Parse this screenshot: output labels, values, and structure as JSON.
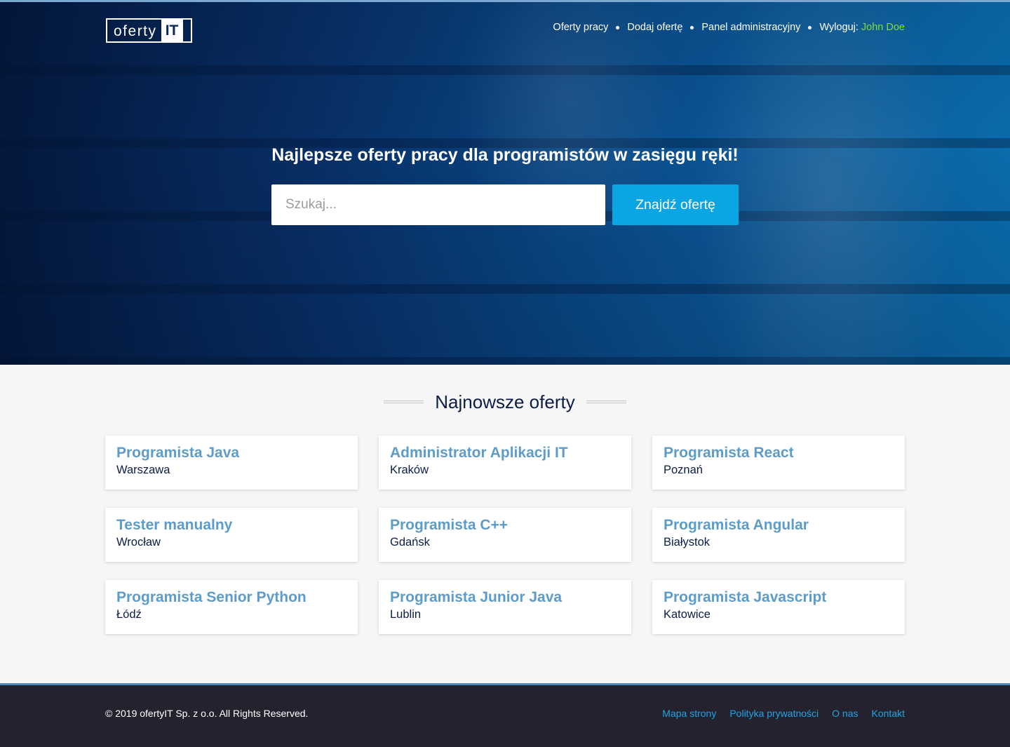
{
  "logo": {
    "part1": "oferty",
    "part2": "IT"
  },
  "nav": {
    "items": [
      "Oferty pracy",
      "Dodaj ofertę",
      "Panel administracyjny"
    ],
    "logout_label": "Wyloguj:",
    "user_name": "John Doe"
  },
  "hero": {
    "title": "Najlepsze oferty pracy dla programistów w zasięgu ręki!",
    "search_placeholder": "Szukaj...",
    "search_button": "Znajdź ofertę"
  },
  "offers": {
    "title": "Najnowsze oferty",
    "items": [
      {
        "title": "Programista Java",
        "city": "Warszawa"
      },
      {
        "title": "Administrator Aplikacji IT",
        "city": "Kraków"
      },
      {
        "title": "Programista React",
        "city": "Poznań"
      },
      {
        "title": "Tester manualny",
        "city": "Wrocław"
      },
      {
        "title": "Programista C++",
        "city": "Gdańsk"
      },
      {
        "title": "Programista Angular",
        "city": "Białystok"
      },
      {
        "title": "Programista Senior Python",
        "city": "Łódź"
      },
      {
        "title": "Programista Junior Java",
        "city": "Lublin"
      },
      {
        "title": "Programista Javascript",
        "city": "Katowice"
      }
    ]
  },
  "footer": {
    "copyright": "© 2019 ofertyIT Sp. z o.o. All Rights Reserved.",
    "links": [
      "Mapa strony",
      "Polityka prywatności",
      "O nas",
      "Kontakt"
    ]
  },
  "colors": {
    "accent": "#0aa5e3",
    "job_title": "#5d9cc9",
    "user_name": "#7fdc3a",
    "footer_bg": "#25222f"
  }
}
